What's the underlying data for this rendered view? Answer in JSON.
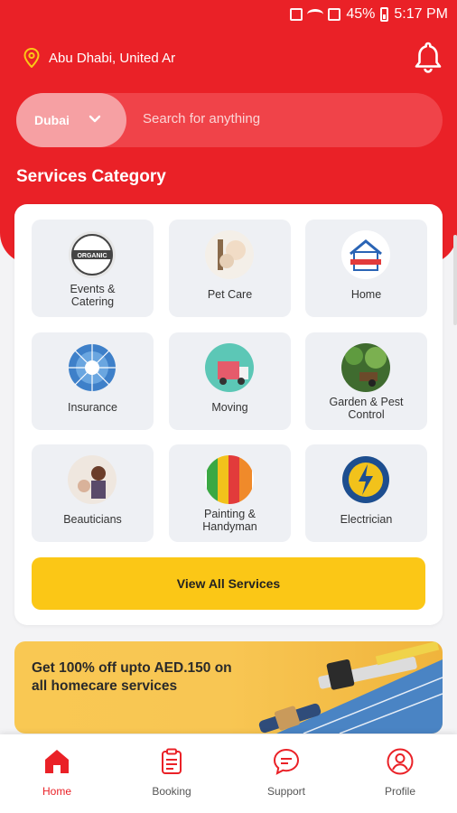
{
  "status_bar": {
    "battery": "45%",
    "time": "5:17 PM"
  },
  "header": {
    "location": "Abu Dhabi, United Ar"
  },
  "search": {
    "city": "Dubai",
    "placeholder": "Search for anything"
  },
  "section": {
    "title": "Services Category"
  },
  "categories": [
    {
      "label": "Events &\nCatering",
      "icon": "organic-badge-icon"
    },
    {
      "label": "Pet Care",
      "icon": "pet-care-icon"
    },
    {
      "label": "Home",
      "icon": "home-service-icon"
    },
    {
      "label": "Insurance",
      "icon": "insurance-wheel-icon"
    },
    {
      "label": "Moving",
      "icon": "moving-icon"
    },
    {
      "label": "Garden & Pest\nControl",
      "icon": "garden-icon"
    },
    {
      "label": "Beauticians",
      "icon": "beautician-icon"
    },
    {
      "label": "Painting &\nHandyman",
      "icon": "painting-icon"
    },
    {
      "label": "Electrician",
      "icon": "electrician-badge-icon"
    }
  ],
  "view_all": "View All Services",
  "promo": {
    "text": "Get 100% off upto AED.150 on all homecare services"
  },
  "nav": [
    {
      "label": "Home",
      "icon": "home-icon"
    },
    {
      "label": "Booking",
      "icon": "clipboard-icon"
    },
    {
      "label": "Support",
      "icon": "chat-icon"
    },
    {
      "label": "Profile",
      "icon": "user-icon"
    }
  ],
  "colors": {
    "brand_red": "#ea2127",
    "accent_yellow": "#fbc716"
  }
}
